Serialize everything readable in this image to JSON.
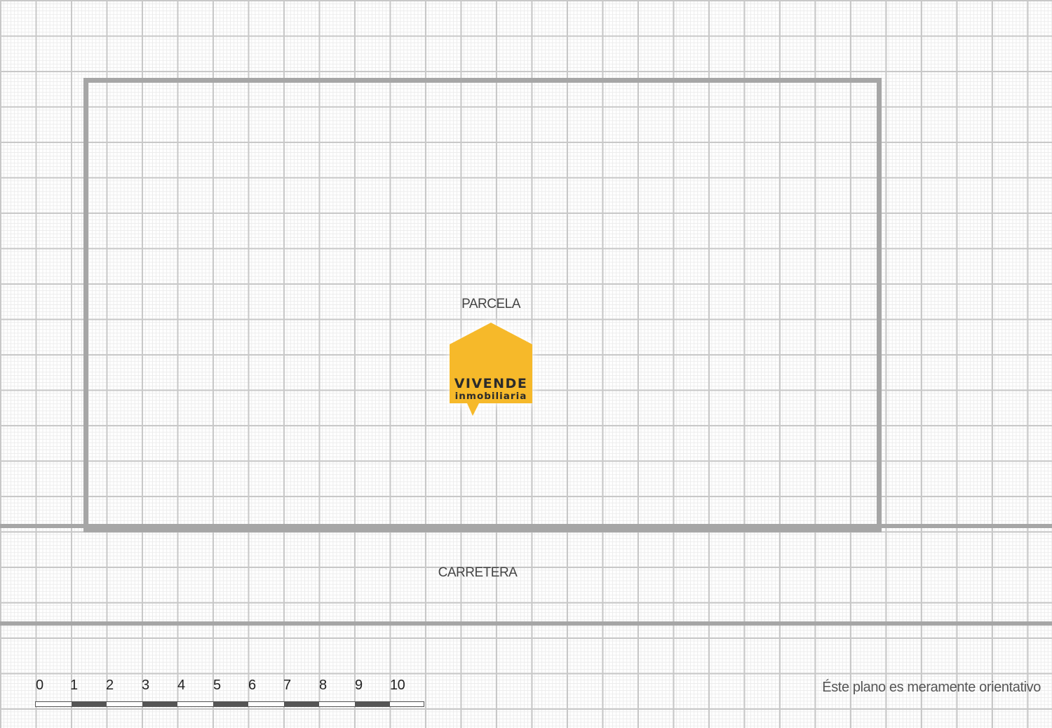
{
  "plan": {
    "parcel_label": "PARCELA",
    "road_label": "CARRETERA",
    "note": "Éste plano es meramente orientativo"
  },
  "logo": {
    "brand": "VIVENDE",
    "subtitle": "inmobiliaria",
    "color": "#f6b92a",
    "text_color": "#2b2b2b"
  },
  "scale": {
    "ticks": [
      "0",
      "1",
      "2",
      "3",
      "4",
      "5",
      "6",
      "7",
      "8",
      "9",
      "10"
    ]
  },
  "colors": {
    "plot_border": "#a6a6a6",
    "grid_major": "#c8c8c8",
    "grid_minor": "#ececec"
  }
}
